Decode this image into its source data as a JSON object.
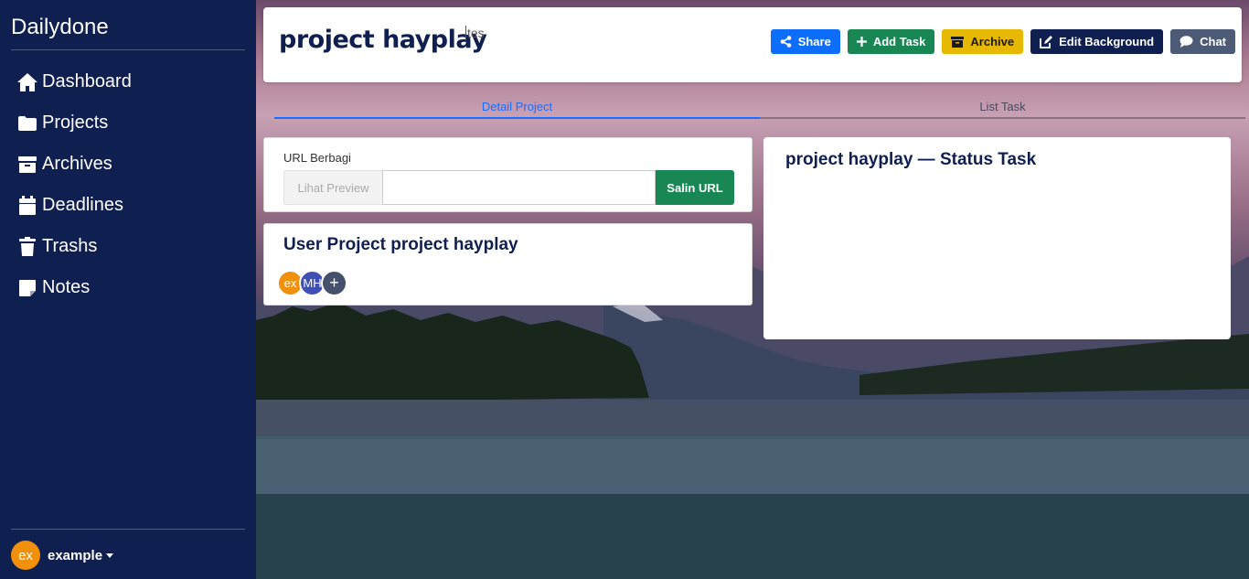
{
  "sidebar": {
    "brand": "Dailydone",
    "items": [
      {
        "label": "Dashboard",
        "icon": "home-icon"
      },
      {
        "label": "Projects",
        "icon": "folder-icon"
      },
      {
        "label": "Archives",
        "icon": "archive-icon"
      },
      {
        "label": "Deadlines",
        "icon": "calendar-icon"
      },
      {
        "label": "Trashs",
        "icon": "trash-icon"
      },
      {
        "label": "Notes",
        "icon": "note-icon"
      }
    ],
    "user": {
      "initials": "ex",
      "name": "example"
    }
  },
  "header": {
    "title": "project hayplay",
    "subtitle": "tes",
    "actions": [
      {
        "label": "Share",
        "icon": "share-icon",
        "color": "#0d6efd"
      },
      {
        "label": "Add Task",
        "icon": "plus-icon",
        "color": "#198754"
      },
      {
        "label": "Archive",
        "icon": "archive-icon",
        "color": "#e6b800"
      },
      {
        "label": "Edit Background",
        "icon": "edit-icon",
        "color": "#0f1f4f"
      },
      {
        "label": "Chat",
        "icon": "chat-icon",
        "color": "#4c5a75"
      }
    ]
  },
  "tabs": [
    {
      "label": "Detail Project",
      "active": true
    },
    {
      "label": "List Task",
      "active": false
    }
  ],
  "share_url": {
    "label": "URL Berbagi",
    "preview_label": "Lihat Preview",
    "input_value": "",
    "copy_label": "Salin URL"
  },
  "users": {
    "title": "User Project project hayplay",
    "avatars": [
      {
        "initials": "ex",
        "color": "#f0900b"
      },
      {
        "initials": "MH",
        "color": "#3f4fb3"
      }
    ],
    "add_label": "+"
  },
  "status": {
    "title": "project hayplay — Status Task"
  }
}
